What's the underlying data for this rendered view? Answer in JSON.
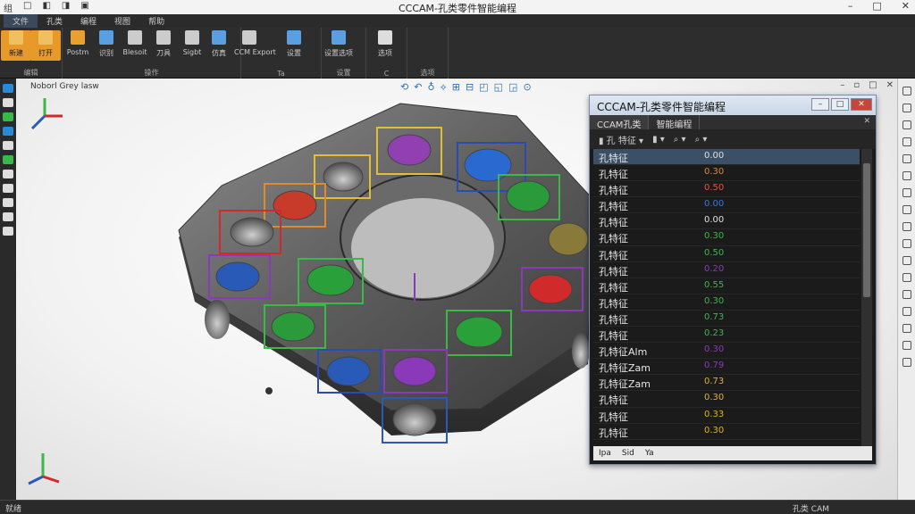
{
  "window": {
    "title": "CCCAM-孔类零件智能编程",
    "minimize": "–",
    "maximize": "□",
    "close": "✕"
  },
  "quick_access": [
    "组",
    "□",
    "◧",
    "◨",
    "▣"
  ],
  "menu": [
    "文件",
    "孔类",
    "编程",
    "视图",
    "帮助"
  ],
  "ribbon": {
    "buttons": [
      {
        "label": "新建",
        "icon": "new-file-icon",
        "color": "#f0c060"
      },
      {
        "label": "打开",
        "icon": "open-folder-icon",
        "color": "#f0c060"
      },
      {
        "label": "Postm",
        "icon": "cube-icon",
        "color": "#e8a030"
      },
      {
        "label": "识别",
        "icon": "feature-icon",
        "color": "#5aa0e0"
      },
      {
        "label": "Blesoit",
        "icon": "plus-icon",
        "color": "#cccccc"
      },
      {
        "label": "刀具",
        "icon": "cursor-icon",
        "color": "#cccccc"
      },
      {
        "label": "Sigbt",
        "icon": "toolpath-icon",
        "color": "#cccccc"
      },
      {
        "label": "仿真",
        "icon": "gear-blue-icon",
        "color": "#5aa0e0"
      },
      {
        "label": "CCM\nExport",
        "icon": "export-icon",
        "color": "#cccccc"
      },
      {
        "label": "设置",
        "icon": "doc-icon",
        "color": "#5aa0e0"
      },
      {
        "label": "设置选项",
        "icon": "settings-grid-icon",
        "color": "#5aa0e0"
      },
      {
        "label": "选项",
        "icon": "gear-icon",
        "color": "#dddddd"
      }
    ],
    "groups": [
      "编辑",
      "操作",
      "Ta",
      "设置",
      "C",
      "选项"
    ]
  },
  "viewport": {
    "label": "Noborl Grey lasw",
    "tools": [
      "⟲",
      "↶",
      "♁",
      "⟡",
      "⊞",
      "⊟",
      "◰",
      "◱",
      "◲",
      "⊙"
    ],
    "controls": [
      "–",
      "▫",
      "□",
      "✕"
    ]
  },
  "panel": {
    "title": "CCCAM-孔类零件智能编程",
    "tabs": [
      "CCAM孔类",
      "智能编程"
    ],
    "toolbar": [
      "▮ 孔 特征 ▾",
      "▮ ▾",
      "⌕ ▾",
      "⌕ ▾"
    ],
    "rows": [
      {
        "name": "孔特征",
        "value": "0.00",
        "color": "#e0e0e0"
      },
      {
        "name": "孔特征",
        "value": "0.30",
        "color": "#d98a3a"
      },
      {
        "name": "孔特征",
        "value": "0.50",
        "color": "#e05a3a"
      },
      {
        "name": "孔特征",
        "value": "0.00",
        "color": "#3a7ad8"
      },
      {
        "name": "孔特征",
        "value": "0.00",
        "color": "#e0e0e0"
      },
      {
        "name": "孔特征",
        "value": "0.30",
        "color": "#3bb84a"
      },
      {
        "name": "孔特征",
        "value": "0.50",
        "color": "#3bb84a"
      },
      {
        "name": "孔特征",
        "value": "0.20",
        "color": "#8a3ab8"
      },
      {
        "name": "孔特征",
        "value": "0.55",
        "color": "#3bb84a"
      },
      {
        "name": "孔特征",
        "value": "0.30",
        "color": "#3bb84a"
      },
      {
        "name": "孔特征",
        "value": "0.73",
        "color": "#3bb84a"
      },
      {
        "name": "孔特征",
        "value": "0.23",
        "color": "#3bb84a"
      },
      {
        "name": "孔特征Alm",
        "value": "0.30",
        "color": "#8a3ab8"
      },
      {
        "name": "孔特征Zam",
        "value": "0.79",
        "color": "#8a3ab8"
      },
      {
        "name": "孔特征Zam",
        "value": "0.73",
        "color": "#e0b030"
      },
      {
        "name": "孔特征",
        "value": "0.30",
        "color": "#e0b030"
      },
      {
        "name": "孔特征",
        "value": "0.33",
        "color": "#e0b030"
      },
      {
        "name": "孔特征",
        "value": "0.30",
        "color": "#e0b030"
      }
    ],
    "status": [
      "Ipa",
      "Sid",
      "Ya"
    ]
  },
  "statusbar": {
    "left": "就绪",
    "right": "孔类 CAM"
  }
}
